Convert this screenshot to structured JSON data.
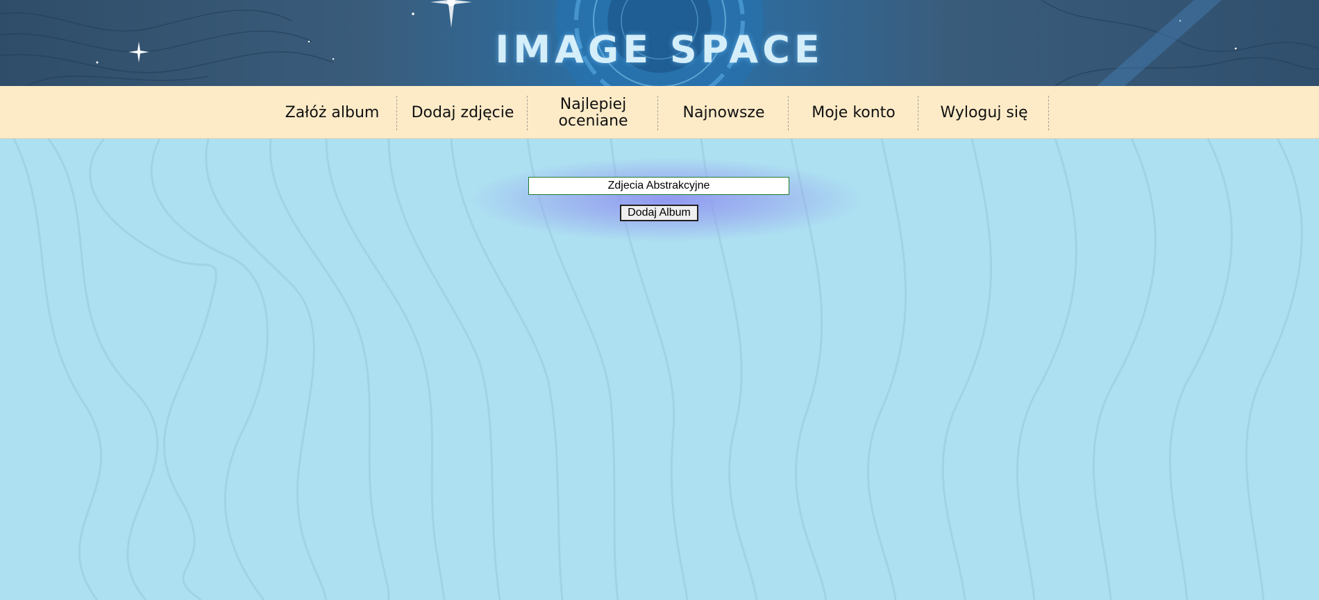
{
  "header": {
    "title": "IMAGE SPACE"
  },
  "nav": {
    "items": [
      {
        "label": "Załóż album"
      },
      {
        "label": "Dodaj zdjęcie"
      },
      {
        "label": "Najlepiej oceniane"
      },
      {
        "label": "Najnowsze"
      },
      {
        "label": "Moje konto"
      },
      {
        "label": "Wyloguj się"
      }
    ]
  },
  "form": {
    "album_name_value": "Zdjecia Abstrakcyjne",
    "submit_label": "Dodaj Album"
  },
  "colors": {
    "page_background": "#ade0f1",
    "nav_background": "#fdebc8",
    "input_border": "#1c7a2b"
  }
}
